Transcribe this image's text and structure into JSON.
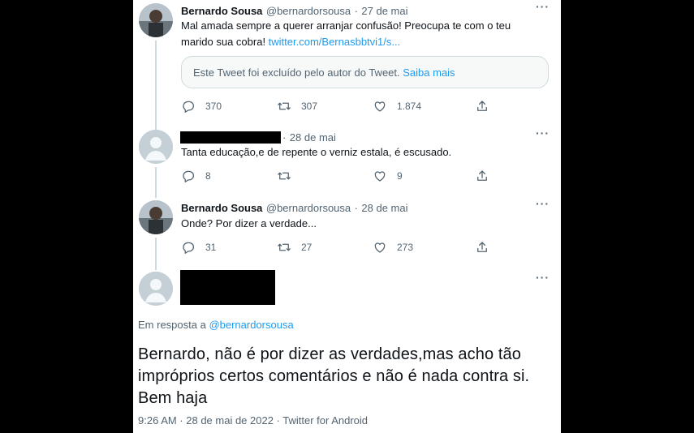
{
  "tweets": [
    {
      "name": "Bernardo Sousa",
      "handle": "@bernardorsousa",
      "separator": "·",
      "date": "27 de mai",
      "text_line1": "Mal amada sempre a querer arranjar confusão! Preocupa te com o teu",
      "text_line2_prefix": "marido sua cobra! ",
      "text_link": "twitter.com/Bernasbbtvi1/s...",
      "quote_notice": "Este Tweet foi excluído pelo autor do Tweet.",
      "quote_link": "Saiba mais",
      "replies": "370",
      "retweets": "307",
      "likes": "1.874"
    },
    {
      "separator": "·",
      "date": "28 de mai",
      "text": "Tanta educação,e de repente o verniz estala, é escusado.",
      "replies": "8",
      "retweets": "",
      "likes": "9"
    },
    {
      "name": "Bernardo Sousa",
      "handle": "@bernardorsousa",
      "separator": "·",
      "date": "28 de mai",
      "text": "Onde? Por dizer a verdade...",
      "replies": "31",
      "retweets": "27",
      "likes": "273"
    }
  ],
  "main_tweet": {
    "reply_prefix": "Em resposta a ",
    "reply_handle": "@bernardorsousa",
    "text_line1": "Bernardo, não é por dizer as verdades,mas acho tão",
    "text_line2": "impróprios certos comentários e não é nada contra si.",
    "text_line3": "Bem haja",
    "timestamp": "9:26 AM · 28 de mai de 2022 · Twitter for Android"
  },
  "more_glyph": "···",
  "icons": {
    "reply": "reply-icon",
    "retweet": "retweet-icon",
    "like": "heart-icon",
    "share": "share-icon",
    "more": "more-icon"
  },
  "colors": {
    "link": "#1d9bf0",
    "muted": "#536471",
    "text": "#0f1419"
  }
}
